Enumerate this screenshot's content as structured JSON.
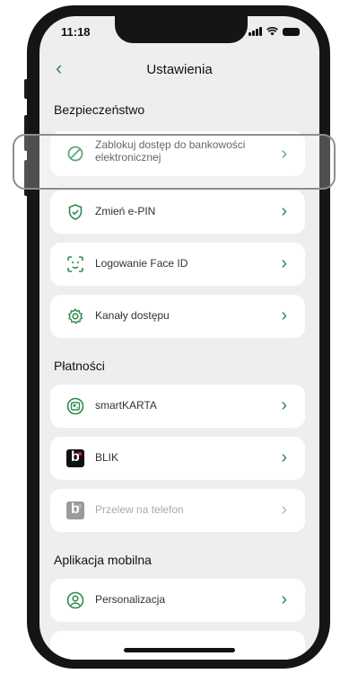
{
  "status_bar": {
    "time": "11:18"
  },
  "nav": {
    "back_icon": "chevron-left-icon",
    "title": "Ustawienia"
  },
  "sections": {
    "security": {
      "title": "Bezpieczeństwo",
      "items": [
        {
          "label": "Zablokuj dostęp do bankowości elektronicznej",
          "icon": "block-icon"
        },
        {
          "label": "Zmień e-PIN",
          "icon": "shield-check-icon"
        },
        {
          "label": "Logowanie Face ID",
          "icon": "face-id-icon"
        },
        {
          "label": "Kanały dostępu",
          "icon": "gear-icon"
        }
      ]
    },
    "payments": {
      "title": "Płatności",
      "items": [
        {
          "label": "smartKARTA",
          "icon": "smartcard-icon"
        },
        {
          "label": "BLIK",
          "icon": "blik-icon"
        },
        {
          "label": "Przelew na telefon",
          "icon": "blik-icon",
          "disabled": true
        }
      ]
    },
    "mobile_app": {
      "title": "Aplikacja mobilna",
      "items": [
        {
          "label": "Personalizacja",
          "icon": "user-circle-icon"
        }
      ]
    }
  },
  "chevron": "›",
  "colors": {
    "accent": "#2f8a4a",
    "background": "#eeeeee",
    "card": "#ffffff"
  }
}
